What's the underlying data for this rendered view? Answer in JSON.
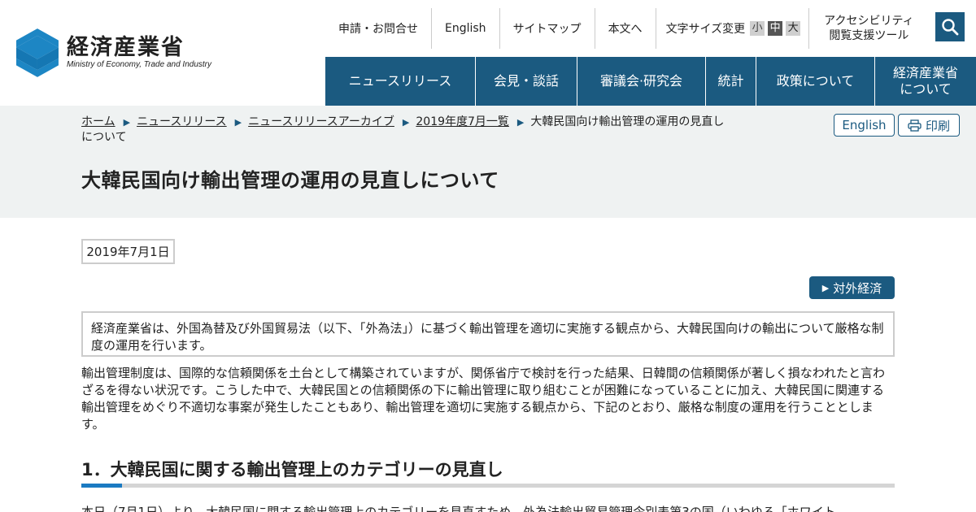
{
  "header": {
    "logo_jp": "経済産業省",
    "logo_en": "Ministry of Economy, Trade and Industry",
    "util": {
      "contact": "申請・お問合せ",
      "english": "English",
      "sitemap": "サイトマップ",
      "skip": "本文へ",
      "font_label": "文字サイズ変更",
      "font_small": "小",
      "font_medium": "中",
      "font_large": "大",
      "access_line1": "アクセシビリティ",
      "access_line2": "閲覧支援ツール"
    },
    "nav": [
      "ニュースリリース",
      "会見・談話",
      "審議会·研究会",
      "統計",
      "政策について",
      "経済産業省",
      "について"
    ]
  },
  "breadcrumb": {
    "home": "ホーム",
    "news": "ニュースリリース",
    "archive": "ニュースリリースアーカイブ",
    "month": "2019年度7月一覧",
    "current": "大韓民国向け輸出管理の運用の見直しについて"
  },
  "buttons": {
    "english": "English",
    "print": "印刷"
  },
  "page": {
    "title": "大韓民国向け輸出管理の運用の見直しについて",
    "date": "2019年7月1日",
    "tag": "対外経済",
    "lead": "経済産業省は、外国為替及び外国貿易法（以下、「外為法」）に基づく輸出管理を適切に実施する観点から、大韓民国向けの輸出について厳格な制度の運用を行います。",
    "body": "輸出管理制度は、国際的な信頼関係を土台として構築されていますが、関係省庁で検討を行った結果、日韓間の信頼関係が著しく損なわれたと言わざるを得ない状況です。こうした中で、大韓民国との信頼関係の下に輸出管理に取り組むことが困難になっていることに加え、大韓民国に関連する輸出管理をめぐり不適切な事案が発生したこともあり、輸出管理を適切に実施する観点から、下記のとおり、厳格な制度の運用を行うこととします。",
    "section1_title": "1．大韓民国に関する輸出管理上のカテゴリーの見直し",
    "section1_body": "本日（7月1日）より、大韓民国に関する輸出管理上のカテゴリーを見直すため、外為法輸出貿易管理令別表第3の国（いわゆる「ホワイト"
  },
  "colors": {
    "brand": "#1b5a80",
    "accent": "#1b7ac2",
    "band": "#eff2f2"
  },
  "icons": [
    "meti-logo-icon",
    "search-icon",
    "arrow-right-icon",
    "printer-icon"
  ]
}
